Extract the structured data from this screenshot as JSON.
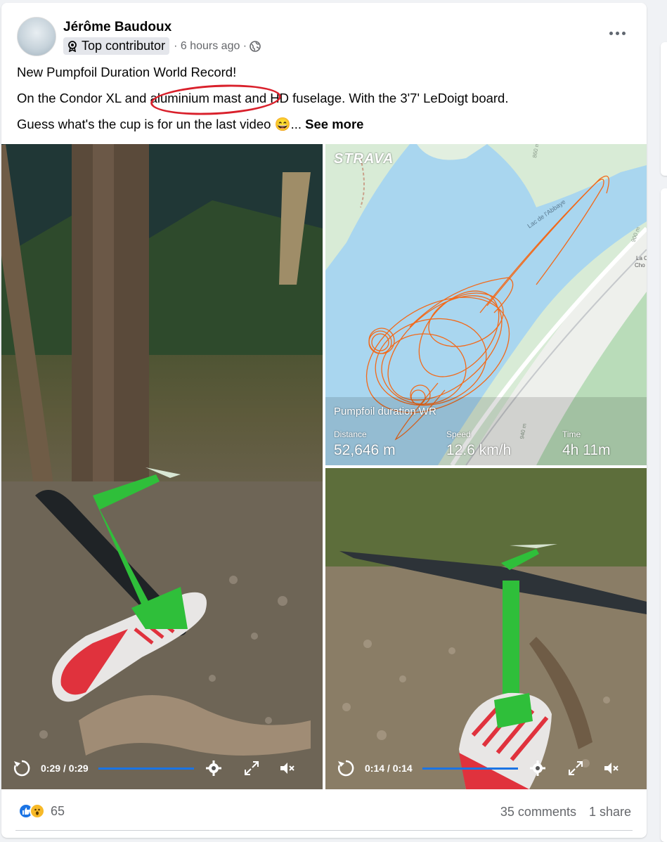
{
  "post": {
    "author": "Jérôme Baudoux",
    "badge": "Top contributor",
    "time": "· 6 hours ago ·",
    "privacy_icon": "globe-icon",
    "line1": "New Pumpfoil Duration World Record!",
    "line2": "On the Condor XL and aluminium mast and HD fuselage. With the 3'7' LeDoigt board.",
    "line3": "Guess what's the cup is for un the last video 😄...",
    "see_more": "See more"
  },
  "map": {
    "brand": "STRAVA",
    "activity": "Pumpfoil duration WR",
    "distance_label": "Distance",
    "distance_value": "52,646 m",
    "speed_label": "Speed",
    "speed_value": "12.6 km/h",
    "time_label": "Time",
    "time_value": "4h 11m",
    "lake_label": "Lac de l'Abbaye",
    "contour1": "860 m",
    "contour2": "900 m",
    "contour3": "940 m",
    "place": "La C\nChoo",
    "track_color": "#f26a1b"
  },
  "video_left": {
    "time": "0:29 / 0:29",
    "progress": 1.0
  },
  "video_right": {
    "time": "0:14 / 0:14",
    "progress": 1.0
  },
  "footer": {
    "reaction_count": "65",
    "comments": "35 comments",
    "shares": "1 share"
  },
  "colors": {
    "accent": "#1b74e4",
    "annotation": "#d9202b"
  }
}
